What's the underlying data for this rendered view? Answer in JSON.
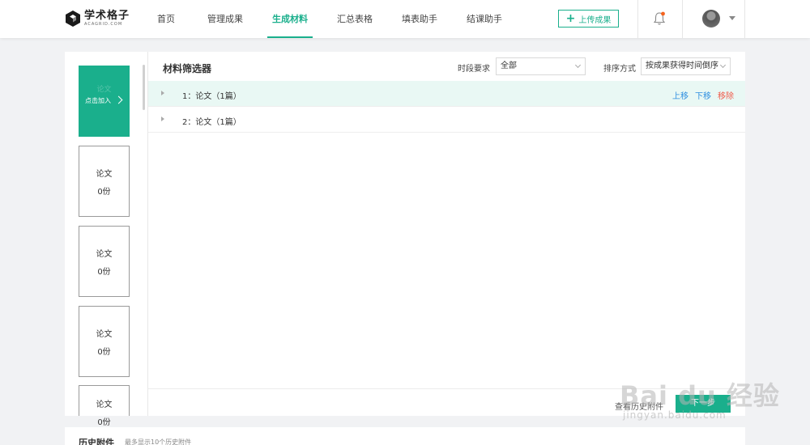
{
  "header": {
    "logo_cn": "学术格子",
    "logo_en": "ACAGRID.COM",
    "nav": [
      "首页",
      "管理成果",
      "生成材料",
      "汇总表格",
      "填表助手",
      "结课助手"
    ],
    "active_nav": "生成材料",
    "upload_label": "上传成果",
    "accent": "#1aaf8c",
    "notification_dot": "#f5631e"
  },
  "sidebar": {
    "add_ghost": "论文",
    "add_label": "点击加入",
    "cards": [
      {
        "title": "论文",
        "count": "0份"
      },
      {
        "title": "论文",
        "count": "0份"
      },
      {
        "title": "论文",
        "count": "0份"
      },
      {
        "title": "论文",
        "count": "0份"
      }
    ]
  },
  "filter": {
    "title": "材料筛选器",
    "period_label": "时段要求",
    "period_value": "全部",
    "sort_label": "排序方式",
    "sort_value": "按成果获得时间倒序"
  },
  "rows": [
    {
      "text": "1：论文（1篇）",
      "up": "上移",
      "down": "下移",
      "remove": "移除"
    },
    {
      "text": "2：论文（1篇）"
    }
  ],
  "footer": {
    "history_link": "查看历史附件",
    "next_label": "下一步"
  },
  "history": {
    "title": "历史附件",
    "subtitle": "最多显示10个历史附件"
  },
  "watermark": {
    "text": "Bai du 经验",
    "url": "jingyan.baidu.com"
  }
}
